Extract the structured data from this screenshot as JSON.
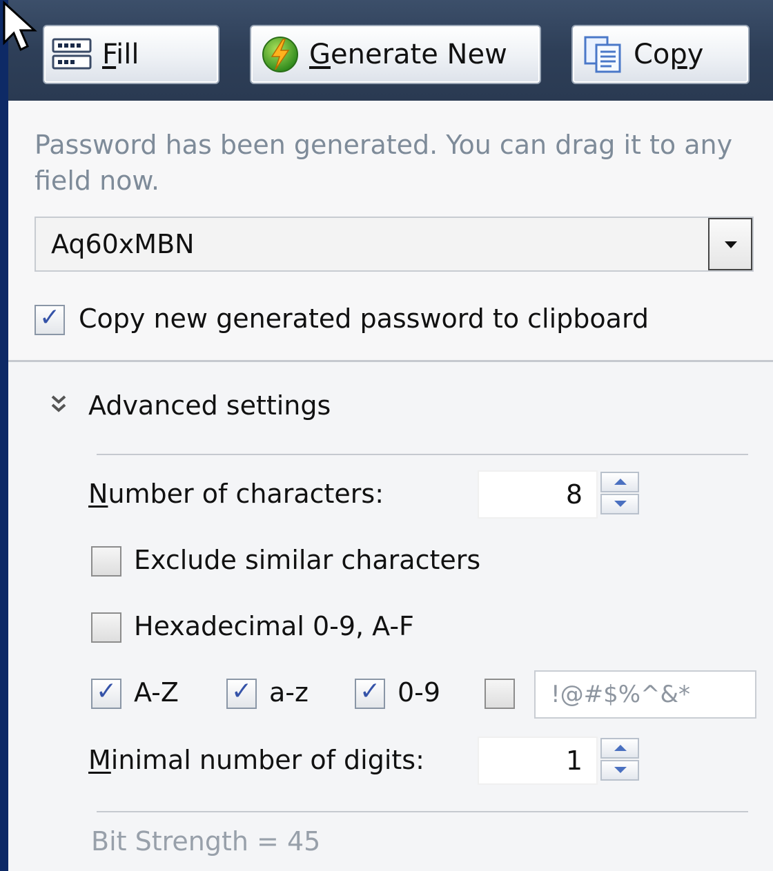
{
  "toolbar": {
    "fill": {
      "underline": "F",
      "rest": "ill",
      "icon": "form-fill-icon"
    },
    "generate": {
      "underline": "G",
      "rest": "enerate New",
      "icon": "lightning-orb-icon"
    },
    "copy": {
      "pre": "Co",
      "underline": "p",
      "rest": "y",
      "icon": "copy-documents-icon"
    }
  },
  "message": "Password has been generated. You can drag it to any field now.",
  "password": {
    "value": "Aq60xMBN"
  },
  "copy_to_clipboard": {
    "label": "Copy new generated password to clipboard",
    "checked": true
  },
  "advanced": {
    "title": "Advanced settings",
    "num_chars": {
      "underline": "N",
      "rest": "umber of characters:",
      "value": "8"
    },
    "exclude_similar": {
      "label": "Exclude similar characters",
      "checked": false
    },
    "hexadecimal": {
      "label": "Hexadecimal 0-9, A-F",
      "checked": false
    },
    "charsets": [
      {
        "label": "A-Z",
        "checked": true
      },
      {
        "label": "a-z",
        "checked": true
      },
      {
        "label": "0-9",
        "checked": true
      },
      {
        "label": "",
        "checked": false
      }
    ],
    "symbols": "!@#$%^&*",
    "min_digits": {
      "underline": "M",
      "rest": "inimal number of digits:",
      "value": "1"
    }
  },
  "bit_strength": "Bit Strength = 45",
  "colors": {
    "frame": "#0e2a66",
    "toolbar": "#2e3f58",
    "accent": "#3553a8"
  }
}
